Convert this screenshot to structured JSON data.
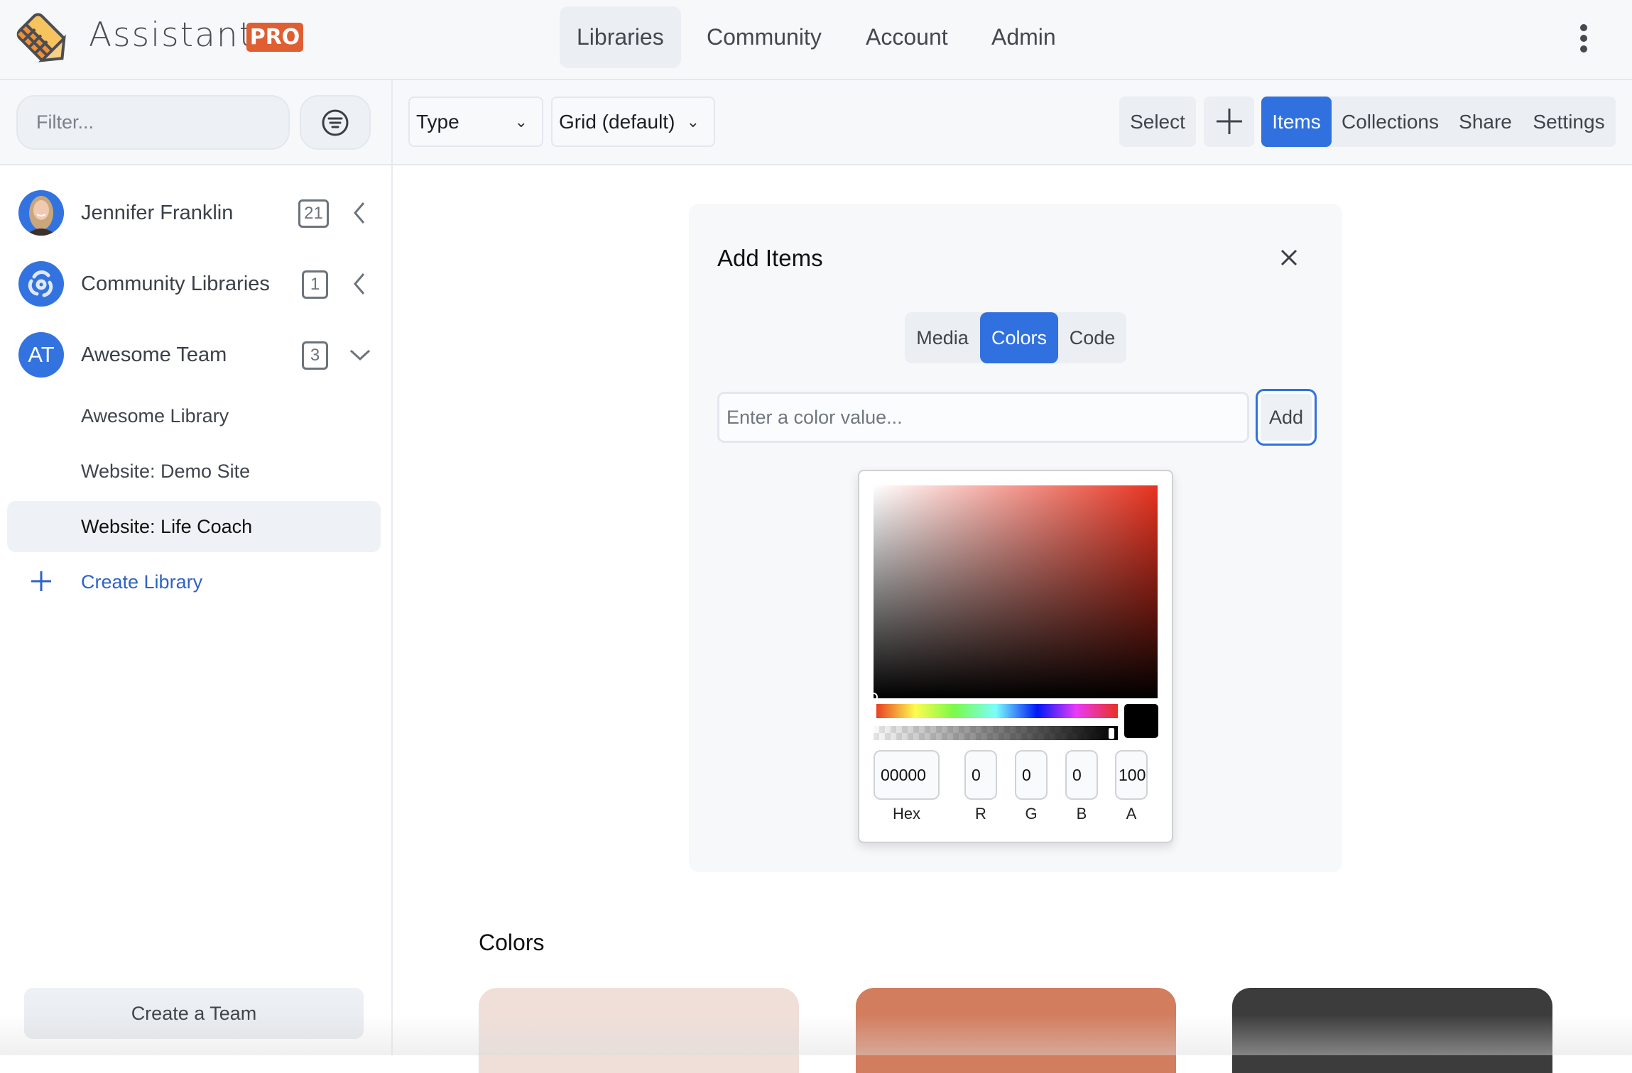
{
  "header": {
    "brand": "Assistant",
    "badge": "PRO",
    "nav": [
      {
        "label": "Libraries",
        "active": true
      },
      {
        "label": "Community",
        "active": false
      },
      {
        "label": "Account",
        "active": false
      },
      {
        "label": "Admin",
        "active": false
      }
    ],
    "menu_icon": "kebab-vertical-icon"
  },
  "toolbar": {
    "filter_placeholder": "Filter...",
    "filter_icon": "filter-lines-icon",
    "type_dropdown": "Type",
    "view_dropdown": "Grid (default)",
    "select_label": "Select",
    "add_icon": "plus-icon",
    "tabs": [
      {
        "label": "Items",
        "active": true
      },
      {
        "label": "Collections",
        "active": false
      },
      {
        "label": "Share",
        "active": false
      },
      {
        "label": "Settings",
        "active": false
      }
    ]
  },
  "sidebar": {
    "groups": [
      {
        "label": "Jennifer Franklin",
        "count": "21",
        "avatar": "user-photo",
        "expanded": false
      },
      {
        "label": "Community Libraries",
        "count": "1",
        "avatar": "community-swirl-icon",
        "expanded": false
      },
      {
        "label": "Awesome Team",
        "count": "3",
        "avatar_initials": "AT",
        "expanded": true
      }
    ],
    "libraries": [
      {
        "label": "Awesome Library",
        "active": false
      },
      {
        "label": "Website: Demo Site",
        "active": false
      },
      {
        "label": "Website: Life Coach",
        "active": true
      }
    ],
    "create_library": "Create Library",
    "create_team": "Create a Team"
  },
  "modal": {
    "title": "Add Items",
    "tabs": [
      {
        "label": "Media",
        "active": false
      },
      {
        "label": "Colors",
        "active": true
      },
      {
        "label": "Code",
        "active": false
      }
    ],
    "color_input_placeholder": "Enter a color value...",
    "add_label": "Add",
    "picker": {
      "hue_color": "#e8321f",
      "selected_color": "#000000",
      "hex": "00000",
      "r": "0",
      "g": "0",
      "b": "0",
      "a": "100",
      "labels": {
        "hex": "Hex",
        "r": "R",
        "g": "G",
        "b": "B",
        "a": "A"
      }
    }
  },
  "colors_section": {
    "heading": "Colors",
    "swatches": [
      "#f0dfd9",
      "#d37d5f",
      "#3c3c3c"
    ]
  }
}
